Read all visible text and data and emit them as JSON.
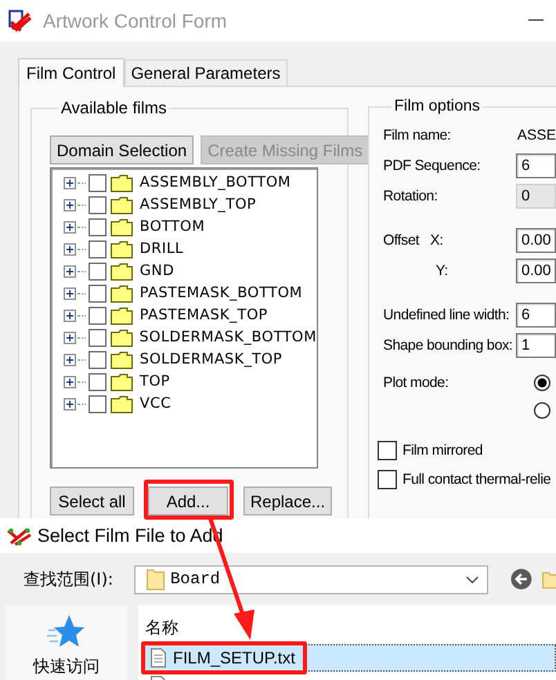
{
  "window": {
    "title": "Artwork Control Form"
  },
  "tabs": [
    {
      "label": "Film Control",
      "selected": true
    },
    {
      "label": "General Parameters",
      "selected": false
    }
  ],
  "available_films": {
    "title": "Available films",
    "top_buttons": [
      {
        "label": "Domain Selection",
        "disabled": false
      },
      {
        "label": "Create Missing Films",
        "disabled": true
      }
    ],
    "films": [
      {
        "label": "ASSEMBLY_BOTTOM",
        "checked": false
      },
      {
        "label": "ASSEMBLY_TOP",
        "checked": false
      },
      {
        "label": "BOTTOM",
        "checked": false
      },
      {
        "label": "DRILL",
        "checked": false
      },
      {
        "label": "GND",
        "checked": false
      },
      {
        "label": "PASTEMASK_BOTTOM",
        "checked": false
      },
      {
        "label": "PASTEMASK_TOP",
        "checked": false
      },
      {
        "label": "SOLDERMASK_BOTTOM",
        "checked": false
      },
      {
        "label": "SOLDERMASK_TOP",
        "checked": false
      },
      {
        "label": "TOP",
        "checked": false
      },
      {
        "label": "VCC",
        "checked": false
      }
    ],
    "bottom_buttons": [
      {
        "label": "Select all",
        "annotated": false
      },
      {
        "label": "Add...",
        "annotated": true
      },
      {
        "label": "Replace...",
        "annotated": false
      }
    ]
  },
  "film_options": {
    "title": "Film options",
    "groups": [
      [
        {
          "kind": "text",
          "label": "Film name:",
          "value": "ASSE"
        },
        {
          "kind": "field",
          "label": "PDF Sequence:",
          "value": "6",
          "disabled": false
        },
        {
          "kind": "field",
          "label": "Rotation:",
          "value": "0",
          "disabled": true
        }
      ],
      [
        {
          "kind": "offset",
          "label": "Offset",
          "axis": "X:",
          "value": "0.00"
        },
        {
          "kind": "offset",
          "axis": "Y:",
          "value": "0.00"
        }
      ],
      [
        {
          "kind": "field",
          "label": "Undefined line width:",
          "value": "6",
          "disabled": false
        },
        {
          "kind": "field",
          "label": "Shape bounding box:",
          "value": "1",
          "disabled": false
        }
      ]
    ],
    "plot_mode": {
      "label": "Plot mode:",
      "options": [
        {
          "selected": true
        },
        {
          "selected": false
        }
      ]
    },
    "checkboxes": [
      {
        "label": "Film mirrored",
        "checked": false
      },
      {
        "label": "Full contact thermal-relie",
        "checked": false
      }
    ]
  },
  "file_dialog": {
    "title": "Select Film File to Add",
    "look_in_label": "查找范围(I):",
    "look_in_value": "Board",
    "quick_access": "快速访问",
    "column": "名称",
    "files": [
      {
        "name": "FILM_SETUP.txt",
        "selected": true,
        "annotated": true
      },
      {
        "selected": false,
        "annotated": false
      }
    ]
  }
}
